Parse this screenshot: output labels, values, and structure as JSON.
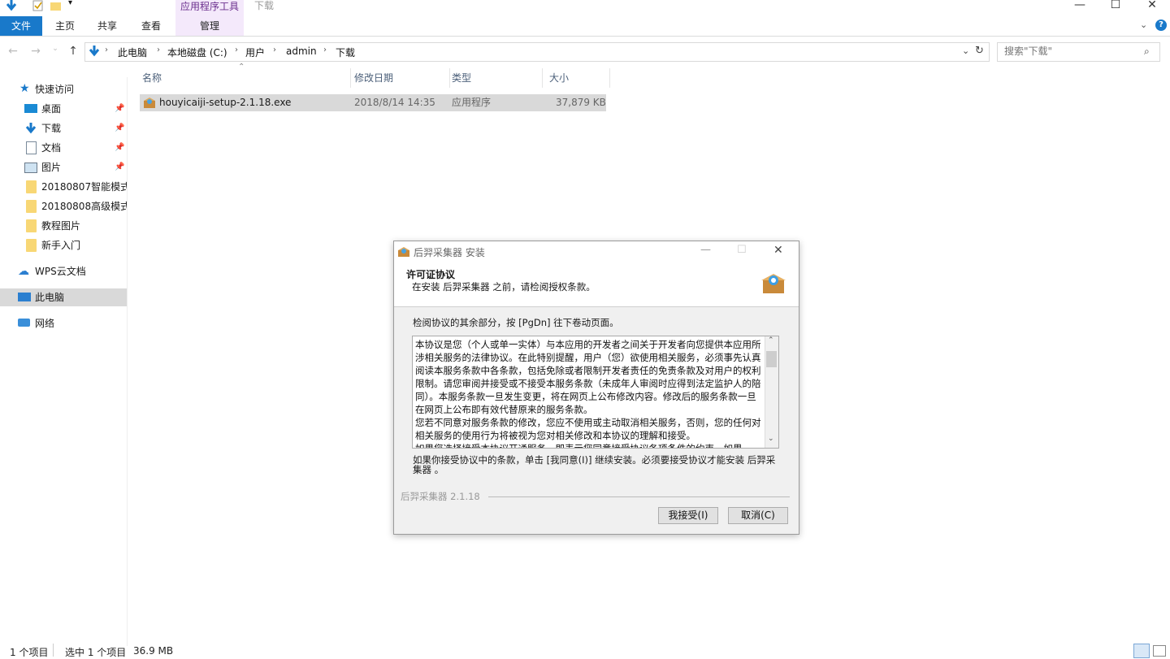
{
  "window": {
    "title": "下载",
    "context_tab_label": "应用程序工具"
  },
  "ribbon": {
    "tabs": [
      "文件",
      "主页",
      "共享",
      "查看",
      "管理"
    ]
  },
  "address": {
    "crumbs": [
      "此电脑",
      "本地磁盘 (C:)",
      "用户",
      "admin",
      "下载"
    ]
  },
  "search": {
    "placeholder": "搜索\"下载\""
  },
  "sidebar": {
    "quick_access": "快速访问",
    "items": [
      {
        "label": "桌面",
        "icon": "desktop-icon",
        "pinned": true
      },
      {
        "label": "下载",
        "icon": "download-icon",
        "pinned": true
      },
      {
        "label": "文档",
        "icon": "document-icon",
        "pinned": true
      },
      {
        "label": "图片",
        "icon": "picture-icon",
        "pinned": true
      },
      {
        "label": "20180807智能模式",
        "icon": "folder-icon",
        "pinned": false
      },
      {
        "label": "20180808高级模式",
        "icon": "folder-icon",
        "pinned": false
      },
      {
        "label": "教程图片",
        "icon": "folder-icon",
        "pinned": false
      },
      {
        "label": "新手入门",
        "icon": "folder-icon",
        "pinned": false
      }
    ],
    "wps": "WPS云文档",
    "this_pc": "此电脑",
    "network": "网络"
  },
  "file_list": {
    "columns": [
      "名称",
      "修改日期",
      "类型",
      "大小"
    ],
    "rows": [
      {
        "name": "houyicaiji-setup-2.1.18.exe",
        "date": "2018/8/14 14:35",
        "type": "应用程序",
        "size": "37,879 KB"
      }
    ]
  },
  "status": {
    "count": "1 个项目",
    "selected": "选中 1 个项目",
    "size": "36.9 MB"
  },
  "dialog": {
    "title": "后羿采集器 安装",
    "header_title": "许可证协议",
    "header_subtitle": "在安装 后羿采集器 之前，请检阅授权条款。",
    "instruction": "检阅协议的其余部分，按 [PgDn] 往下卷动页面。",
    "eula": "本协议是您（个人或单一实体）与本应用的开发者之间关于开发者向您提供本应用所涉相关服务的法律协议。在此特别提醒，用户（您）欲使用相关服务，必须事先认真阅读本服务条款中各条款，包括免除或者限制开发者责任的免责条款及对用户的权利限制。请您审阅并接受或不接受本服务条款（未成年人审阅时应得到法定监护人的陪同）。本服务条款一旦发生变更，将在网页上公布修改内容。修改后的服务条款一旦在网页上公布即有效代替原来的服务条款。\n您若不同意对服务条款的修改，您应不使用或主动取消相关服务，否则，您的任何对相关服务的使用行为将被视为您对相关修改和本协议的理解和接受。\n如果您选择接受本协议开通服务，即表示您同意接受协议各项条件的约束。如果",
    "accept_note": "如果你接受协议中的条款，单击 [我同意(I)] 继续安装。必须要接受协议才能安装 后羿采集器 。",
    "version": "后羿采集器 2.1.18",
    "accept_button": "我接受(I)",
    "cancel_button": "取消(C)"
  },
  "colors": {
    "accent": "#1979ca",
    "context_tab": "#f4e9fb",
    "selected_row": "#d9d9d9"
  }
}
